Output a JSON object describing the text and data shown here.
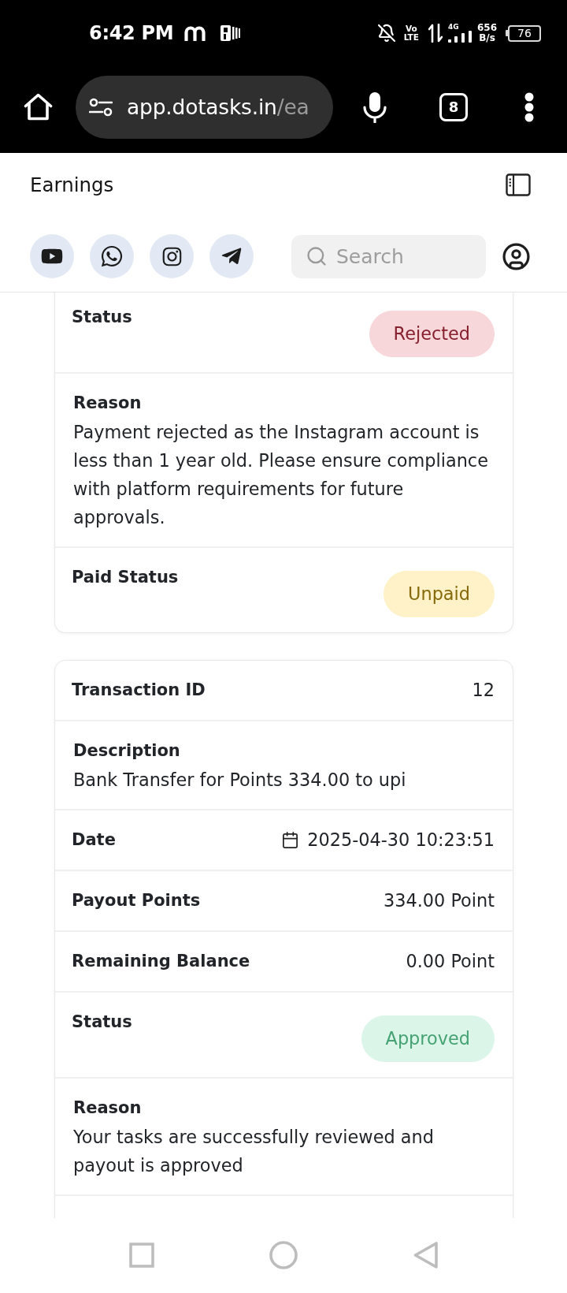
{
  "status_bar": {
    "time": "6:42 PM",
    "volte": [
      "Vo",
      "LTE"
    ],
    "network_type": "4G",
    "speed": "656",
    "speed_unit": "B/s",
    "battery": "76"
  },
  "browser": {
    "url_host": "app.dotasks.in",
    "url_path": "/ea",
    "tab_count": "8"
  },
  "header": {
    "title": "Earnings",
    "search": {
      "placeholder": "Search"
    }
  },
  "transactions": [
    {
      "rows": [
        {
          "kind": "badge",
          "label": "Status",
          "badge": {
            "text": "Rejected",
            "kind": "danger"
          }
        },
        {
          "kind": "text",
          "label": "Reason",
          "text": "Payment rejected as the Instagram account is less than 1 year old. Please ensure compliance with platform requirements for future approvals."
        },
        {
          "kind": "badge",
          "label": "Paid Status",
          "badge": {
            "text": "Unpaid",
            "kind": "warning"
          }
        }
      ]
    },
    {
      "rows": [
        {
          "kind": "pair",
          "label": "Transaction ID",
          "value": "12"
        },
        {
          "kind": "text",
          "label": "Description",
          "text": "Bank Transfer for Points 334.00 to upi"
        },
        {
          "kind": "date",
          "label": "Date",
          "value": "2025-04-30 10:23:51"
        },
        {
          "kind": "pair",
          "label": "Payout Points",
          "value": "334.00 Point"
        },
        {
          "kind": "pair",
          "label": "Remaining Balance",
          "value": "0.00 Point"
        },
        {
          "kind": "badge",
          "label": "Status",
          "badge": {
            "text": "Approved",
            "kind": "success"
          }
        },
        {
          "kind": "text",
          "label": "Reason",
          "text": "Your tasks are successfully reviewed and payout is approved"
        }
      ]
    }
  ]
}
